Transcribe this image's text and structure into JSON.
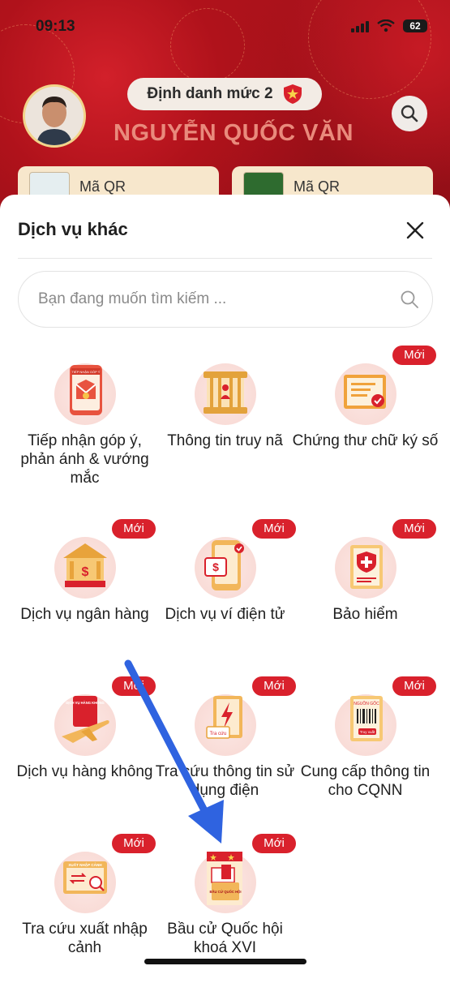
{
  "status": {
    "time": "09:13",
    "battery": "62"
  },
  "header": {
    "level_label": "Định danh mức 2",
    "user_name": "NGUYỄN QUỐC VĂN",
    "qr_cards": [
      "Mã QR",
      "Mã QR"
    ]
  },
  "sheet": {
    "title": "Dịch vụ khác",
    "search_placeholder": "Bạn đang muốn tìm kiếm ...",
    "badge_new": "Mới",
    "services": [
      {
        "label": "Tiếp nhận góp ý, phản ánh & vướng mắc",
        "icon": "feedback-icon",
        "new": false
      },
      {
        "label": "Thông tin truy nã",
        "icon": "wanted-icon",
        "new": false
      },
      {
        "label": "Chứng thư chữ ký số",
        "icon": "certificate-icon",
        "new": true
      },
      {
        "label": "Dịch vụ ngân hàng",
        "icon": "bank-icon",
        "new": true
      },
      {
        "label": "Dịch vụ ví điện tử",
        "icon": "e-wallet-icon",
        "new": true
      },
      {
        "label": "Bảo hiểm",
        "icon": "insurance-icon",
        "new": true
      },
      {
        "label": "Dịch vụ hàng không",
        "icon": "airplane-icon",
        "new": true
      },
      {
        "label": "Tra cứu thông tin sử dụng điện",
        "icon": "electricity-icon",
        "new": true
      },
      {
        "label": "Cung cấp thông tin cho CQNN",
        "icon": "barcode-icon",
        "new": true
      },
      {
        "label": "Tra cứu xuất nhập cảnh",
        "icon": "immigration-icon",
        "new": true
      },
      {
        "label": "Bầu cử Quốc hội khoá XVI",
        "icon": "ballot-icon",
        "new": true
      }
    ],
    "icon_texts": {
      "feedback": "TIẾP NHẬN GÓP Ý",
      "electricity": "Tra cứu",
      "barcode_top": "NGUỒN GỐC",
      "barcode_bottom": "Truy xuất",
      "airline": "DỊCH VỤ HÀNG KHÔNG",
      "immigration": "XUẤT NHẬP CẢNH",
      "ballot": "BẦU CỬ QUỐC HỘI"
    }
  },
  "colors": {
    "brand_red": "#d9212c",
    "header_red": "#a8121b",
    "annotation_arrow": "#2f63e0"
  }
}
